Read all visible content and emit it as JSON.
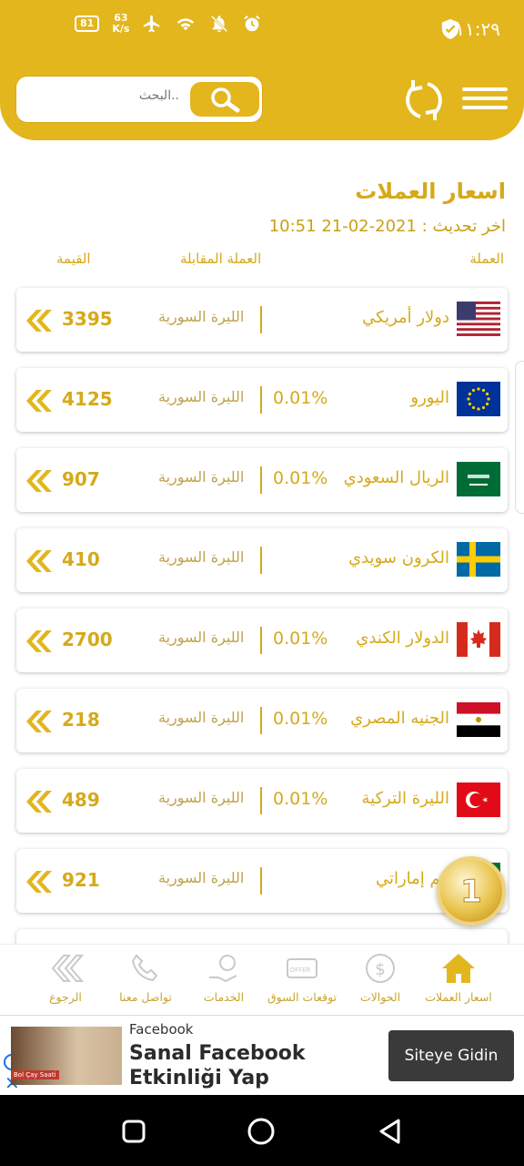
{
  "status": {
    "time": "١١:٢٩",
    "battery": "81",
    "speed_value": "63",
    "speed_unit": "K/s"
  },
  "search": {
    "placeholder": "البحث.."
  },
  "page": {
    "title": "اسعار العملات",
    "updated": "اخر تحديث : 2021-02-21 10:51"
  },
  "columns": {
    "currency": "العملة",
    "counter": "العملة المقابلة",
    "value": "القيمة"
  },
  "colors": {
    "accent": "#e3b61e",
    "text": "#d6a91a"
  },
  "rows": [
    {
      "flag": "us-flag-icon",
      "name": "دولار أمريكي",
      "pct": "",
      "target": "الليرة السورية",
      "value": "3395"
    },
    {
      "flag": "eu-flag-icon",
      "name": "اليورو",
      "pct": "0.01%",
      "target": "الليرة السورية",
      "value": "4125"
    },
    {
      "flag": "sa-flag-icon",
      "name": "الريال السعودي",
      "pct": "0.01%",
      "target": "الليرة السورية",
      "value": "907"
    },
    {
      "flag": "se-flag-icon",
      "name": "الكرون سويدي",
      "pct": "",
      "target": "الليرة السورية",
      "value": "410"
    },
    {
      "flag": "ca-flag-icon",
      "name": "الدولار الكندي",
      "pct": "0.01%",
      "target": "الليرة السورية",
      "value": "2700"
    },
    {
      "flag": "eg-flag-icon",
      "name": "الجنيه المصري",
      "pct": "0.01%",
      "target": "الليرة السورية",
      "value": "218"
    },
    {
      "flag": "tr-flag-icon",
      "name": "الليرة التركية",
      "pct": "0.01%",
      "target": "الليرة السورية",
      "value": "489"
    },
    {
      "flag": "ae-flag-icon",
      "name": "هم إماراتي",
      "pct": "",
      "target": "الليرة السورية",
      "value": "921"
    }
  ],
  "nav": [
    {
      "label": "اسعار العملات",
      "icon": "home-icon"
    },
    {
      "label": "الحوالات",
      "icon": "transfer-icon"
    },
    {
      "label": "توقعات السوق",
      "icon": "offer-card-icon"
    },
    {
      "label": "الخدمات",
      "icon": "services-icon"
    },
    {
      "label": "تواصل معنا",
      "icon": "phone-icon"
    },
    {
      "label": "الرجوع",
      "icon": "back-icon"
    }
  ],
  "ad": {
    "source": "Facebook",
    "title": "Sanal Facebook Etkinliği Yap",
    "cta": "Siteye Gidin",
    "image_text": "Bol Çay Saati"
  }
}
